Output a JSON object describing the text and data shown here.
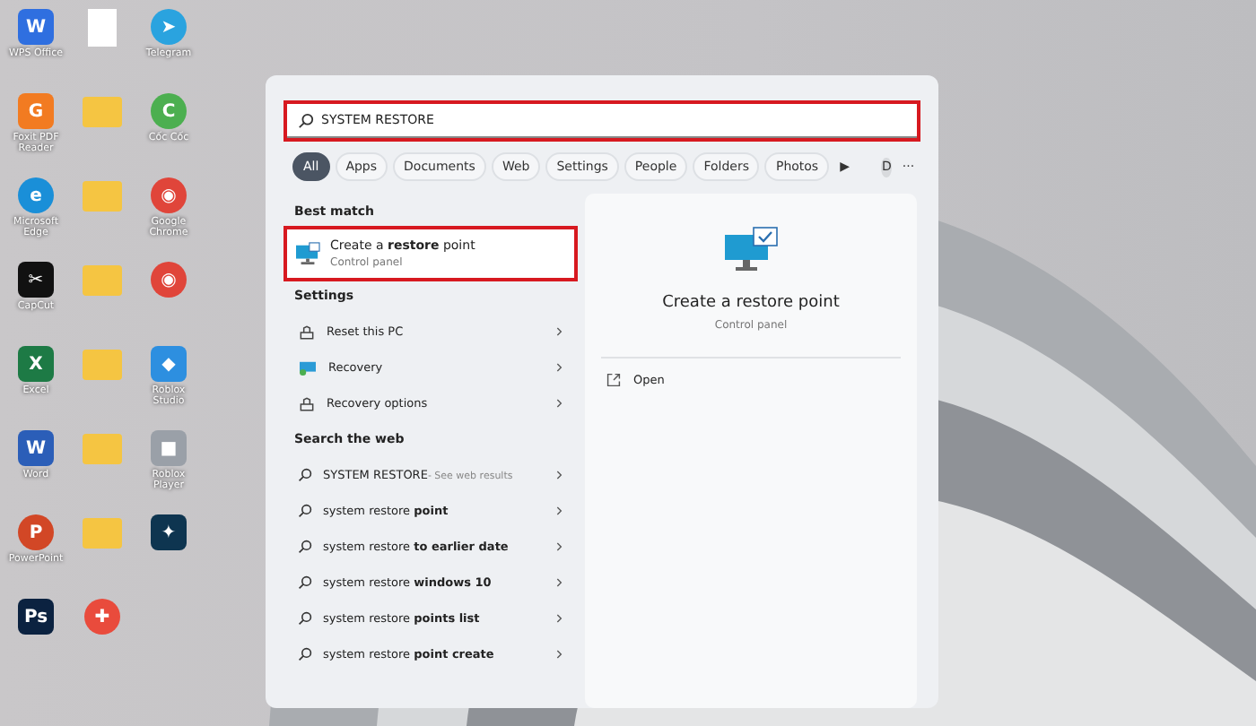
{
  "desktop": {
    "icons": [
      {
        "kind": "tile",
        "color": "#2f6fe0",
        "glyph": "W",
        "label": "WPS Office"
      },
      {
        "kind": "doc",
        "color": "#ffffff"
      },
      {
        "kind": "circle",
        "color": "#2aa3df",
        "glyph": "➤",
        "label": "Telegram"
      },
      {
        "kind": "tile",
        "color": "#f27b21",
        "glyph": "G",
        "label": "Foxit PDF Reader"
      },
      {
        "kind": "folder",
        "color": "#f5c542"
      },
      {
        "kind": "circle",
        "color": "#4caf50",
        "glyph": "C",
        "label": "Cốc Cốc"
      },
      {
        "kind": "circle",
        "color": "#1a8fd8",
        "glyph": "e",
        "label": "Microsoft Edge"
      },
      {
        "kind": "folder",
        "color": "#f5c542"
      },
      {
        "kind": "circle",
        "color": "#e0453a",
        "glyph": "◉",
        "label": "Google Chrome"
      },
      {
        "kind": "tile",
        "color": "#111111",
        "glyph": "✂",
        "label": "CapCut"
      },
      {
        "kind": "folder",
        "color": "#f5c542"
      },
      {
        "kind": "circle",
        "color": "#e0453a",
        "glyph": "◉"
      },
      {
        "kind": "tile",
        "color": "#1d7a45",
        "glyph": "X",
        "label": "Excel"
      },
      {
        "kind": "folder",
        "color": "#f5c542"
      },
      {
        "kind": "tile",
        "color": "#2d8fe0",
        "glyph": "◆",
        "label": "Roblox Studio"
      },
      {
        "kind": "tile",
        "color": "#2b5eb8",
        "glyph": "W",
        "label": "Word"
      },
      {
        "kind": "folder",
        "color": "#f5c542"
      },
      {
        "kind": "tile",
        "color": "#9aa0a8",
        "glyph": "■",
        "label": "Roblox Player"
      },
      {
        "kind": "circle",
        "color": "#d24726",
        "glyph": "P",
        "label": "PowerPoint"
      },
      {
        "kind": "folder",
        "color": "#f5c542"
      },
      {
        "kind": "tile",
        "color": "#0e3550",
        "glyph": "✦"
      },
      {
        "kind": "tile",
        "color": "#0b2240",
        "glyph": "Ps"
      },
      {
        "kind": "circle",
        "color": "#e94b3c",
        "glyph": "✚"
      }
    ]
  },
  "search": {
    "value": "SYSTEM RESTORE",
    "highlighted": true
  },
  "filters": [
    {
      "label": "All",
      "selected": true
    },
    {
      "label": "Apps",
      "selected": false
    },
    {
      "label": "Documents",
      "selected": false
    },
    {
      "label": "Web",
      "selected": false
    },
    {
      "label": "Settings",
      "selected": false
    },
    {
      "label": "People",
      "selected": false
    },
    {
      "label": "Folders",
      "selected": false
    },
    {
      "label": "Photos",
      "selected": false
    }
  ],
  "more_filters": "▶",
  "account": "D",
  "overflow": "···",
  "sections": [
    {
      "title": "Best match",
      "items": [
        {
          "kind": "best",
          "text": "Create a **restore** point",
          "subtitle": "Control panel",
          "selected": true,
          "highlighted": true
        }
      ]
    },
    {
      "title": "Settings",
      "items": [
        {
          "kind": "reset",
          "text": "Reset this PC"
        },
        {
          "kind": "recovery",
          "text": "Recovery"
        },
        {
          "kind": "reset",
          "text": "Recovery options"
        }
      ]
    },
    {
      "title": "Search the web",
      "items": [
        {
          "kind": "web",
          "text": "SYSTEM RESTORE",
          "hint": "- See web results"
        },
        {
          "kind": "web",
          "text": "system restore **point**"
        },
        {
          "kind": "web",
          "text": "system restore **to earlier date**"
        },
        {
          "kind": "web",
          "text": "system restore **windows 10**"
        },
        {
          "kind": "web",
          "text": "system restore **points list**"
        },
        {
          "kind": "web",
          "text": "system restore **point create**"
        }
      ]
    }
  ],
  "preview": {
    "title": "Create a restore point",
    "subtitle": "Control panel",
    "actions": [
      "Open"
    ]
  }
}
